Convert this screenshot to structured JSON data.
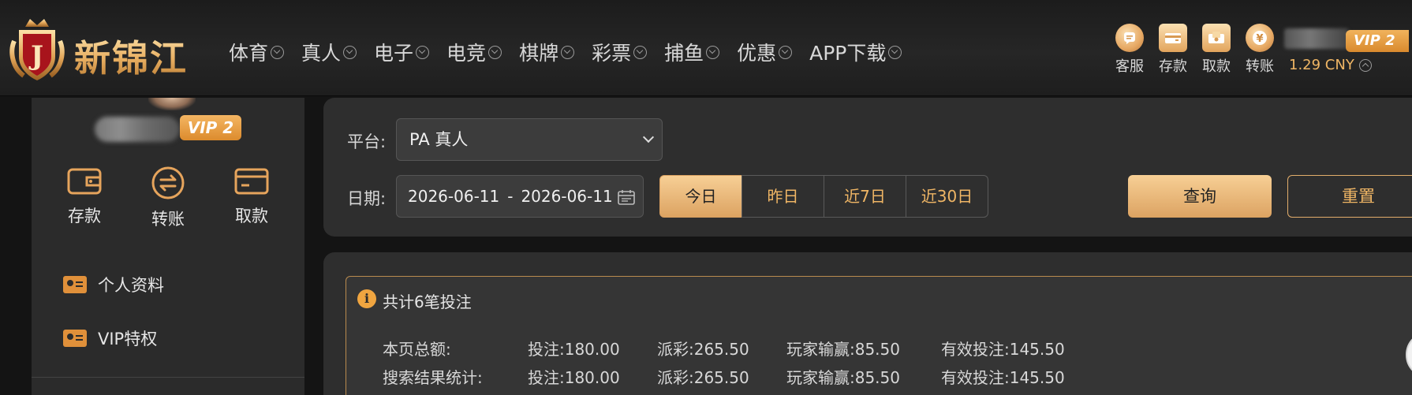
{
  "brand": {
    "logo_text": "新锦江",
    "logo_letter": "J"
  },
  "nav": {
    "items": [
      {
        "label": "体育"
      },
      {
        "label": "真人"
      },
      {
        "label": "电子"
      },
      {
        "label": "电竞"
      },
      {
        "label": "棋牌"
      },
      {
        "label": "彩票"
      },
      {
        "label": "捕鱼"
      },
      {
        "label": "优惠"
      },
      {
        "label": "APP下载"
      }
    ]
  },
  "header_actions": [
    {
      "label": "客服",
      "icon": "chat-icon"
    },
    {
      "label": "存款",
      "icon": "wallet-icon"
    },
    {
      "label": "取款",
      "icon": "withdraw-icon"
    },
    {
      "label": "转账",
      "icon": "yuan-icon"
    }
  ],
  "account": {
    "vip_badge": "VIP 2",
    "balance": "1.29 CNY"
  },
  "sidebar": {
    "vip_badge": "VIP 2",
    "actions": [
      {
        "label": "存款",
        "icon": "wallet-icon"
      },
      {
        "label": "转账",
        "icon": "transfer-icon"
      },
      {
        "label": "取款",
        "icon": "card-icon"
      }
    ],
    "menu": [
      {
        "label": "个人资料",
        "icon": "profile-card-icon"
      },
      {
        "label": "VIP特权",
        "icon": "vip-card-icon"
      }
    ]
  },
  "filter": {
    "platform_label": "平台:",
    "platform_value": "PA 真人",
    "date_label": "日期:",
    "date_start": "2026-06-11",
    "date_sep": "-",
    "date_end": "2026-06-11",
    "ranges": [
      "今日",
      "昨日",
      "近7日",
      "近30日"
    ],
    "active_range": "今日",
    "query_label": "查询",
    "reset_label": "重置"
  },
  "summary": {
    "title": "共计6笔投注",
    "rows": [
      {
        "label": "本页总额:",
        "bet": "投注:180.00",
        "payout": "派彩:265.50",
        "win_loss": "玩家输赢:85.50",
        "valid_bet": "有效投注:145.50"
      },
      {
        "label": "搜索结果统计:",
        "bet": "投注:180.00",
        "payout": "派彩:265.50",
        "win_loss": "玩家输赢:85.50",
        "valid_bet": "有效投注:145.50"
      }
    ]
  },
  "colors": {
    "accent": "#e8b06a",
    "accent_dark": "#dca362",
    "vip_orange": "#e8952f",
    "background": "#141414",
    "panel": "#2e2e2e"
  }
}
